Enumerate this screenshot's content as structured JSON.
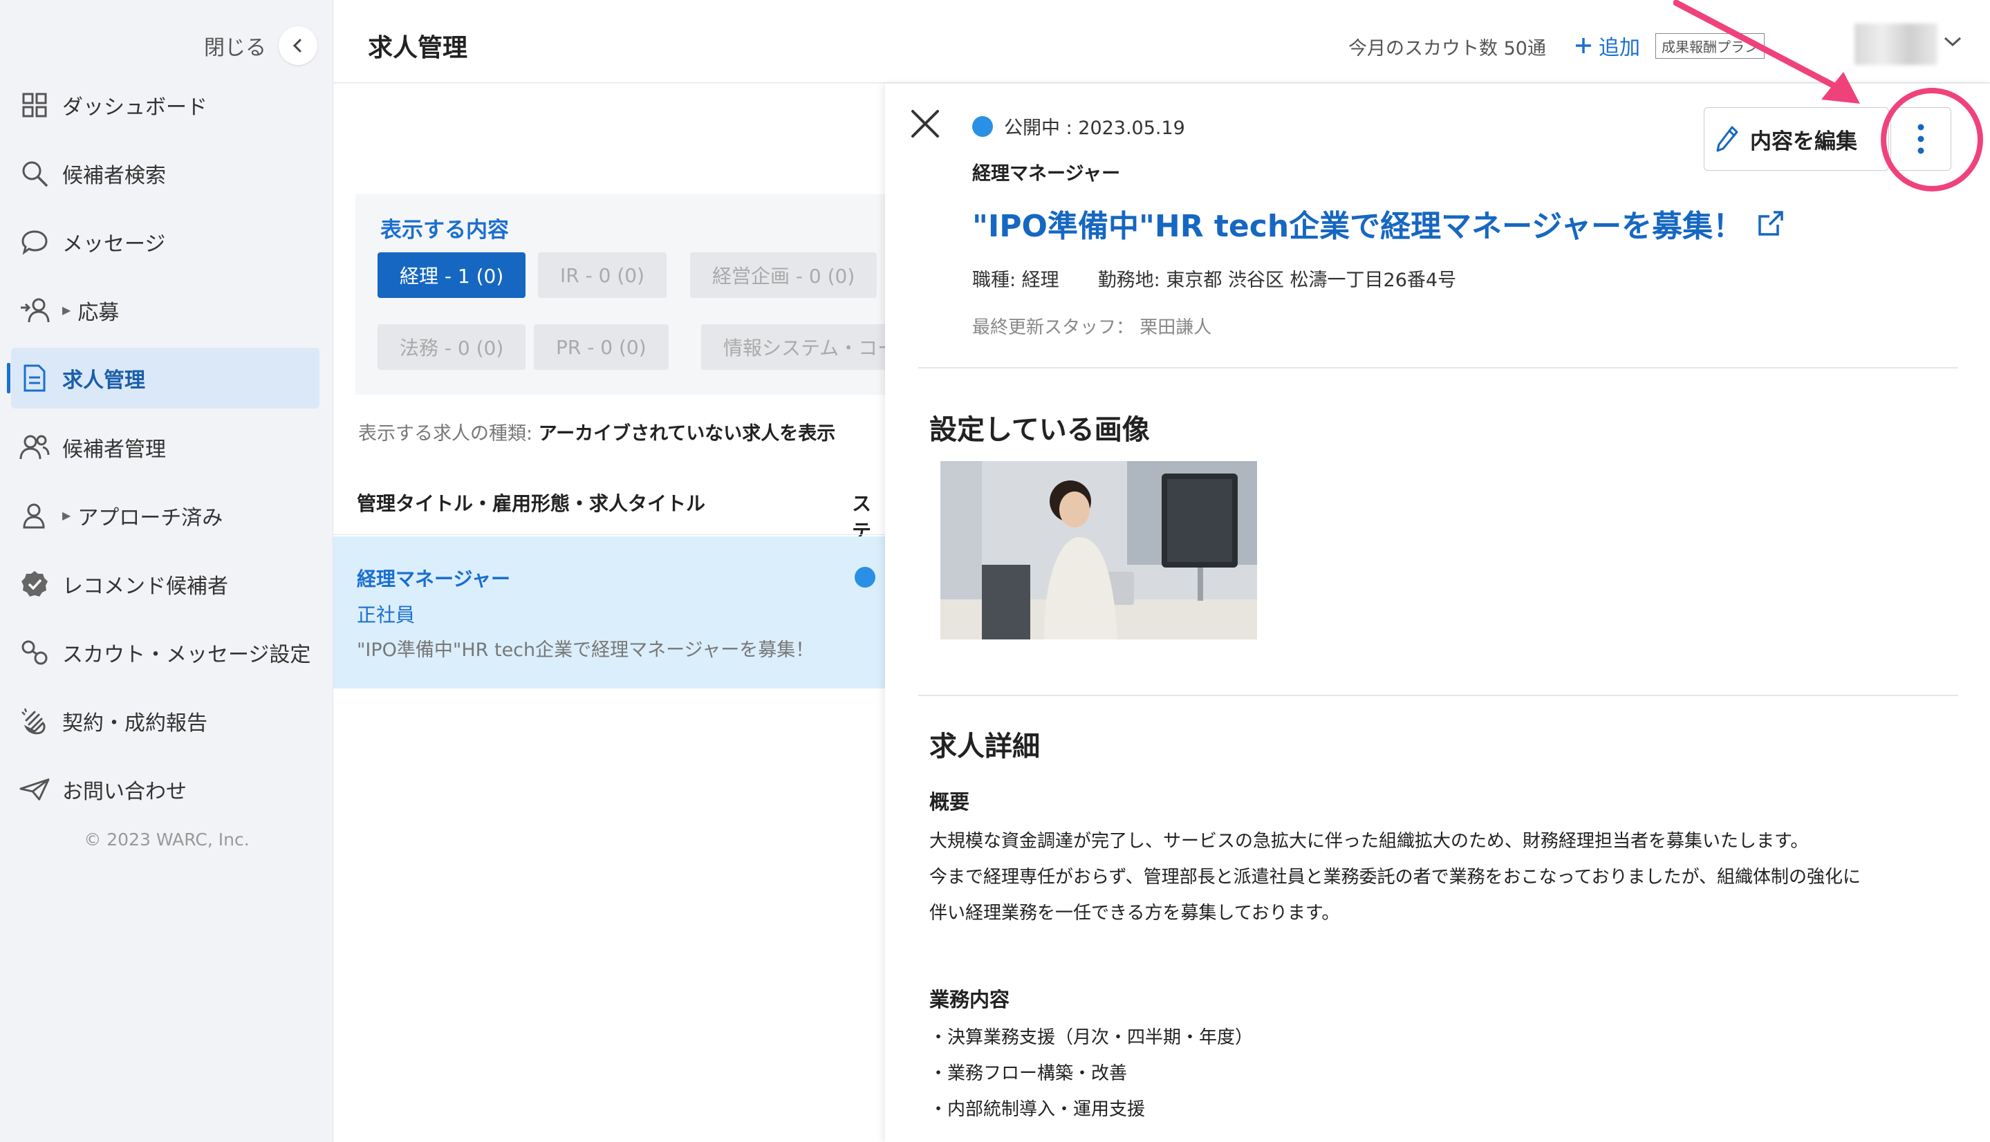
{
  "sidebar": {
    "close_label": "閉じる",
    "items": [
      {
        "label": "ダッシュボード",
        "icon": "dashboard-icon"
      },
      {
        "label": "候補者検索",
        "icon": "search-icon"
      },
      {
        "label": "メッセージ",
        "icon": "chat-icon"
      },
      {
        "label": "応募",
        "icon": "applicant-icon"
      },
      {
        "label": "求人管理",
        "icon": "document-icon"
      },
      {
        "label": "候補者管理",
        "icon": "people-icon"
      },
      {
        "label": "アプローチ済み",
        "icon": "person-icon"
      },
      {
        "label": "レコメンド候補者",
        "icon": "verified-badge-icon"
      },
      {
        "label": "スカウト・メッセージ設定",
        "icon": "settings-link-icon"
      },
      {
        "label": "契約・成約報告",
        "icon": "clap-icon"
      },
      {
        "label": "お問い合わせ",
        "icon": "paper-plane-icon"
      }
    ],
    "copyright": "© 2023 WARC, Inc."
  },
  "header": {
    "title": "求人管理",
    "scout_count": "今月のスカウト数 50通",
    "add_label": "追加",
    "plan_badge": "成果報酬プラン"
  },
  "filters": {
    "title": "表示する内容",
    "chips": [
      "経理 - 1 (0)",
      "IR - 0 (0)",
      "経営企画 - 0 (0)",
      "法務 - 0 (0)",
      "PR - 0 (0)",
      "情報システム・コーポ"
    ],
    "archive_label": "表示する求人の種類:",
    "archive_value": "アーカイブされていない求人を表示"
  },
  "table": {
    "col1": "管理タイトル・雇用形態・求人タイトル",
    "col2": "ステ",
    "rows": [
      {
        "title": "経理マネージャー",
        "employment": "正社員",
        "job_title": "\"IPO準備中\"HR tech企業で経理マネージャーを募集！"
      }
    ]
  },
  "detail": {
    "status": "公開中 : 2023.05.19",
    "mgmt_title": "経理マネージャー",
    "heading": "\"IPO準備中\"HR tech企業で経理マネージャーを募集！",
    "job_type": "職種: 経理",
    "location": "勤務地: 東京都 渋谷区 松濤一丁目26番4号",
    "last_updated": "最終更新スタッフ： 栗田謙人",
    "edit_label": "内容を編集",
    "images_title": "設定している画像",
    "details_title": "求人詳細",
    "overview_title": "概要",
    "overview_lines": [
      "大規模な資金調達が完了し、サービスの急拡大に伴った組織拡大のため、財務経理担当者を募集いたします。",
      "今まで経理専任がおらず、管理部長と派遣社員と業務委託の者で業務をおこなっておりましたが、組織体制の強化に",
      "伴い経理業務を一任できる方を募集しております。"
    ],
    "duties_title": "業務内容",
    "duties": [
      "・決算業務支援（月次・四半期・年度）",
      "・業務フロー構築・改善",
      "・内部統制導入・運用支援"
    ]
  },
  "colors": {
    "accent": "#1667c2",
    "annotation": "#f0427a",
    "selected_row": "#dbeefb"
  }
}
